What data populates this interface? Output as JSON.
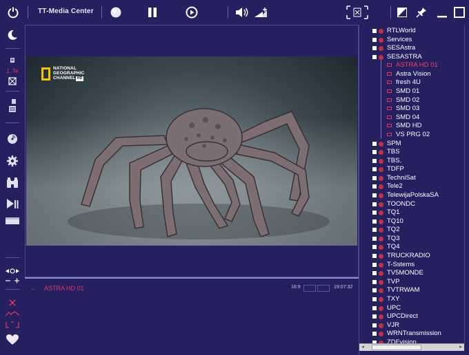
{
  "window": {
    "title": "TT-Media Center"
  },
  "toolbar": {
    "icons": [
      "power-icon",
      "moon-icon",
      "record-icon",
      "pause-icon",
      "play-icon",
      "volume-icon",
      "audio-boost-icon",
      "fullscreen-icon",
      "aspect-icon",
      "pin-icon",
      "minimize-icon",
      "maximize-icon"
    ]
  },
  "sidebar": {
    "icons": [
      "night-icon",
      "timer-icon",
      "epg-icon",
      "list-icon",
      "disc-icon",
      "settings-icon",
      "binoculars-icon",
      "playback-icon",
      "screen-icon",
      "zoom-icon",
      "minus-plus-icon",
      "record-mark-icon",
      "scan-icon",
      "favorite-heart-icon"
    ],
    "timer_label": "1. Te"
  },
  "video": {
    "logo_line1": "NATIONAL",
    "logo_line2": "GEOGRAPHIC",
    "logo_line3": "CHANNEL",
    "logo_hd": "HD"
  },
  "status": {
    "channel": "ASTRA HD 01",
    "aspect": "16:9",
    "time": "19:07:32"
  },
  "tree": {
    "groups_top": [
      "RTLWorld",
      "Services",
      "SESAstra",
      "SESASTRA"
    ],
    "expanded": {
      "channels": [
        "ASTRA HD 01",
        "Astra Vision",
        "fresh 4U",
        "SMD 01",
        "SMD 02",
        "SMD 03",
        "SMD 04",
        "SMD HD",
        "VS PRG 02"
      ],
      "selected_index": 0
    },
    "groups_bottom": [
      "SPM",
      "TBS",
      "TBS.",
      "TDFP",
      "TechniSat",
      "Tele2",
      "TelewijaPolskaSA",
      "TOONDC",
      "TQ1",
      "TQ10",
      "TQ2",
      "TQ3",
      "TQ4",
      "TRUCKRADIO",
      "T-Sstems",
      "TV5MONDE",
      "TVP",
      "TVTRWAM",
      "TXY",
      "UPC",
      "UPCDirect",
      "VJR",
      "WRNTransmission",
      "ZDFvision"
    ]
  },
  "colors": {
    "background": "#25205f",
    "accent": "#e8355a",
    "text": "#ffffff"
  }
}
